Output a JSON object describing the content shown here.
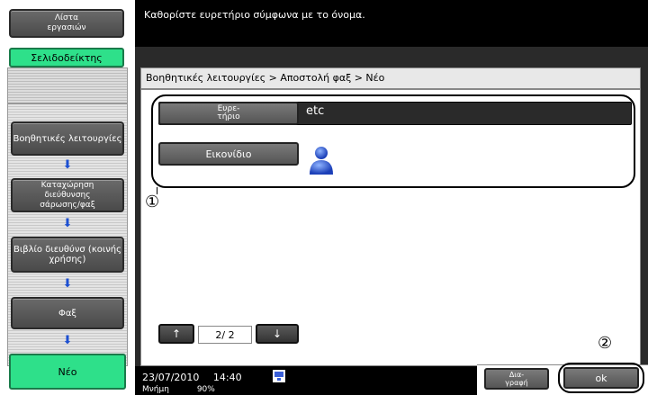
{
  "sidebar": {
    "job_list_label": "Λίστα εργασιών",
    "bookmark_label": "Σελιδοδείκτης",
    "steps": [
      {
        "label": "Βοηθητικές λειτουργίες"
      },
      {
        "label": "Καταχώρηση διεύθυνσης σάρωσης/φαξ"
      },
      {
        "label": "Βιβλίο διευθύνσ (κοινής χρήσης)"
      },
      {
        "label": "Φαξ"
      }
    ],
    "new_label": "Νέο"
  },
  "message": "Καθορίστε ευρετήριο σύμφωνα με το όνομα.",
  "breadcrumb": "Βοηθητικές λειτουργίες > Αποστολή φαξ > Νέο",
  "fields": {
    "index_label": "Ευρε- τήριο",
    "index_value": "etc",
    "icon_label": "Εικονίδιο"
  },
  "callouts": {
    "one": "①",
    "two": "②"
  },
  "pager": {
    "up": "↑",
    "text": "2/ 2",
    "down": "↓"
  },
  "footer": {
    "date": "23/07/2010",
    "time": "14:40",
    "memory_label": "Μνήμη",
    "memory_value": "90%",
    "delete_label": "Δια- γραφή",
    "ok_label": "ok"
  },
  "colors": {
    "accent_green": "#2ee08a",
    "arrow_blue": "#1c4fd1"
  }
}
